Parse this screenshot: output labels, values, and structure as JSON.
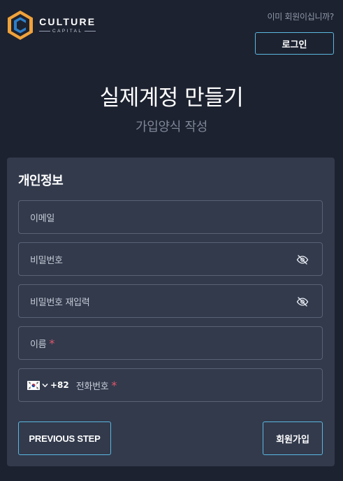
{
  "brand": {
    "name": "CULTURE",
    "sub": "CAPITAL",
    "accent": "#f0a23a",
    "blue": "#2e7fc8"
  },
  "header": {
    "member_prompt": "이미 회원이십니까?",
    "login_label": "로그인"
  },
  "page": {
    "title": "실제계정 만들기",
    "subtitle": "가입양식 작성"
  },
  "form": {
    "section_title": "개인정보",
    "fields": {
      "email": {
        "label": "이메일"
      },
      "password": {
        "label": "비밀번호",
        "icon": "eye-off-icon"
      },
      "password_confirm": {
        "label": "비밀번호 재입력",
        "icon": "eye-off-icon"
      },
      "name": {
        "label": "이름",
        "required_mark": "*"
      },
      "phone": {
        "country_code": "+82",
        "label": "전화번호",
        "required_mark": "*",
        "flag": "kr-flag-icon"
      }
    },
    "buttons": {
      "previous": "PREVIOUS STEP",
      "signup": "회원가입"
    }
  },
  "colors": {
    "background": "#1d2230",
    "card": "#323a4c",
    "button_border": "#5bb8e0",
    "required": "#e0566a"
  }
}
